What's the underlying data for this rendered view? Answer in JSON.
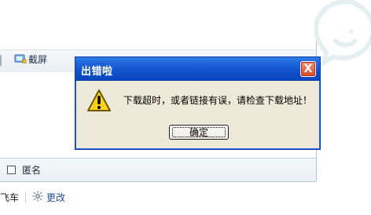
{
  "background": {
    "toolbar": {
      "screenshot_label": "截屏"
    },
    "anonymous_label": "匿名",
    "bottom_links": {
      "fragment_label": "飞车",
      "change_label": "更改"
    }
  },
  "dialog": {
    "title": "出错啦",
    "message": "下载超时，或者链接有误，请检查下载地址！",
    "ok_label": "确定",
    "close_label": "X"
  },
  "icons": {
    "warning": "warning-icon",
    "close": "close-icon",
    "screenshot": "screenshot-icon",
    "gear": "gear-icon",
    "chat": "chat-bubble-icon"
  }
}
